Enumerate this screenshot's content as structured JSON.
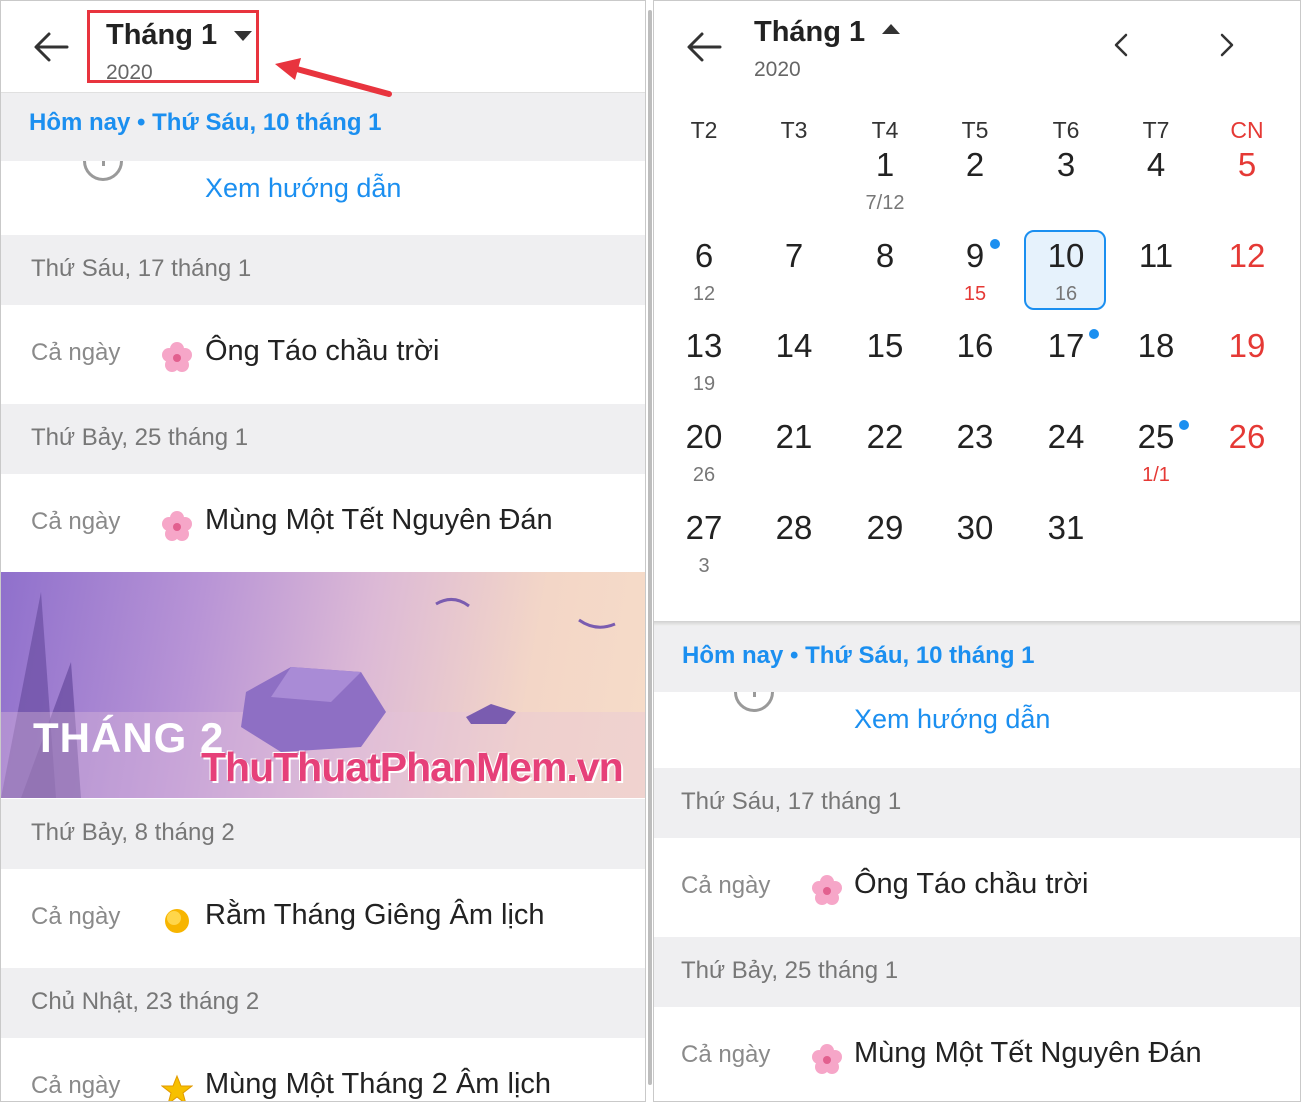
{
  "left": {
    "header": {
      "title": "Tháng 1",
      "year": "2020"
    },
    "today_label": "Hôm nay • Thứ Sáu, 10 tháng 1",
    "guide_link": "Xem hướng dẫn",
    "sections": [
      {
        "date": "Thứ Sáu, 17 tháng 1",
        "allday": "Cả ngày",
        "event": "Ông Táo chầu trời",
        "icon": "flower-icon"
      },
      {
        "date": "Thứ Bảy, 25 tháng 1",
        "allday": "Cả ngày",
        "event": "Mùng Một Tết Nguyên Đán",
        "icon": "flower-icon"
      },
      {
        "date": "Thứ Bảy, 8 tháng 2",
        "allday": "Cả ngày",
        "event": "Rằm Tháng Giêng Âm lịch",
        "icon": "sun-icon"
      },
      {
        "date": "Chủ Nhật, 23 tháng 2",
        "allday": "Cả ngày",
        "event": "Mùng Một Tháng 2 Âm lịch",
        "icon": "star-icon"
      }
    ],
    "banner": {
      "title": "THÁNG 2",
      "watermark": "ThuThuatPhanMem.vn"
    }
  },
  "right": {
    "header": {
      "title": "Tháng 1",
      "year": "2020"
    },
    "weekdays": [
      "T2",
      "T3",
      "T4",
      "T5",
      "T6",
      "T7",
      "CN"
    ],
    "weeks": [
      [
        null,
        null,
        {
          "d": "1",
          "l": "7/12"
        },
        {
          "d": "2"
        },
        {
          "d": "3"
        },
        {
          "d": "4"
        },
        {
          "d": "5"
        }
      ],
      [
        {
          "d": "6",
          "l": "12"
        },
        {
          "d": "7"
        },
        {
          "d": "8"
        },
        {
          "d": "9",
          "l": "15",
          "lred": true,
          "dot": true
        },
        {
          "d": "10",
          "l": "16",
          "selected": true
        },
        {
          "d": "11"
        },
        {
          "d": "12"
        }
      ],
      [
        {
          "d": "13",
          "l": "19"
        },
        {
          "d": "14"
        },
        {
          "d": "15"
        },
        {
          "d": "16"
        },
        {
          "d": "17",
          "dot": true
        },
        {
          "d": "18"
        },
        {
          "d": "19"
        }
      ],
      [
        {
          "d": "20",
          "l": "26"
        },
        {
          "d": "21"
        },
        {
          "d": "22"
        },
        {
          "d": "23"
        },
        {
          "d": "24"
        },
        {
          "d": "25",
          "l": "1/1",
          "lred": true,
          "dot": true
        },
        {
          "d": "26"
        }
      ],
      [
        {
          "d": "27",
          "l": "3"
        },
        {
          "d": "28"
        },
        {
          "d": "29"
        },
        {
          "d": "30"
        },
        {
          "d": "31"
        },
        null,
        null
      ]
    ],
    "today_label": "Hôm nay • Thứ Sáu, 10 tháng 1",
    "guide_link": "Xem hướng dẫn",
    "sections": [
      {
        "date": "Thứ Sáu, 17 tháng 1",
        "allday": "Cả ngày",
        "event": "Ông Táo chầu trời",
        "icon": "flower-icon"
      },
      {
        "date": "Thứ Bảy, 25 tháng 1",
        "allday": "Cả ngày",
        "event": "Mùng Một Tết Nguyên Đán",
        "icon": "flower-icon"
      }
    ]
  },
  "colors": {
    "accent": "#1b8ff0",
    "sunday": "#e53935",
    "highlight": "#e8343e"
  }
}
